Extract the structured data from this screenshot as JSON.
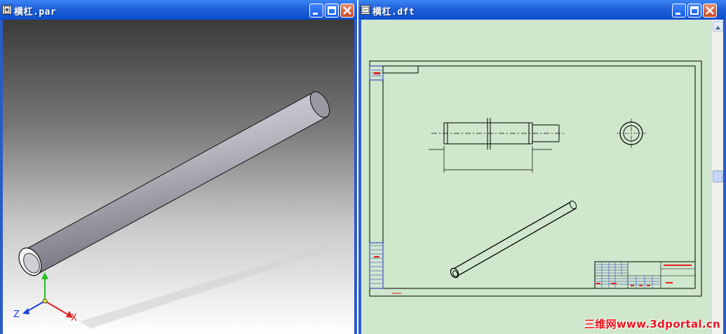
{
  "left_window": {
    "title": "横杠.par",
    "icon": "part-document-icon",
    "axes": {
      "x_label": "X",
      "z_label": "Z"
    }
  },
  "right_window": {
    "title": "横杠.dft",
    "icon": "draft-document-icon"
  },
  "title_buttons": [
    "minimize-icon",
    "maximize-icon",
    "close-icon"
  ],
  "colors": {
    "title_bar": "#1f5fd8",
    "draft_background": "#cfe7cc",
    "watermark": "#e8141c",
    "axis_x": "#e02020",
    "axis_y": "#20c020",
    "axis_z": "#2040e0"
  },
  "watermark": "三维网www.3dportal.cn"
}
